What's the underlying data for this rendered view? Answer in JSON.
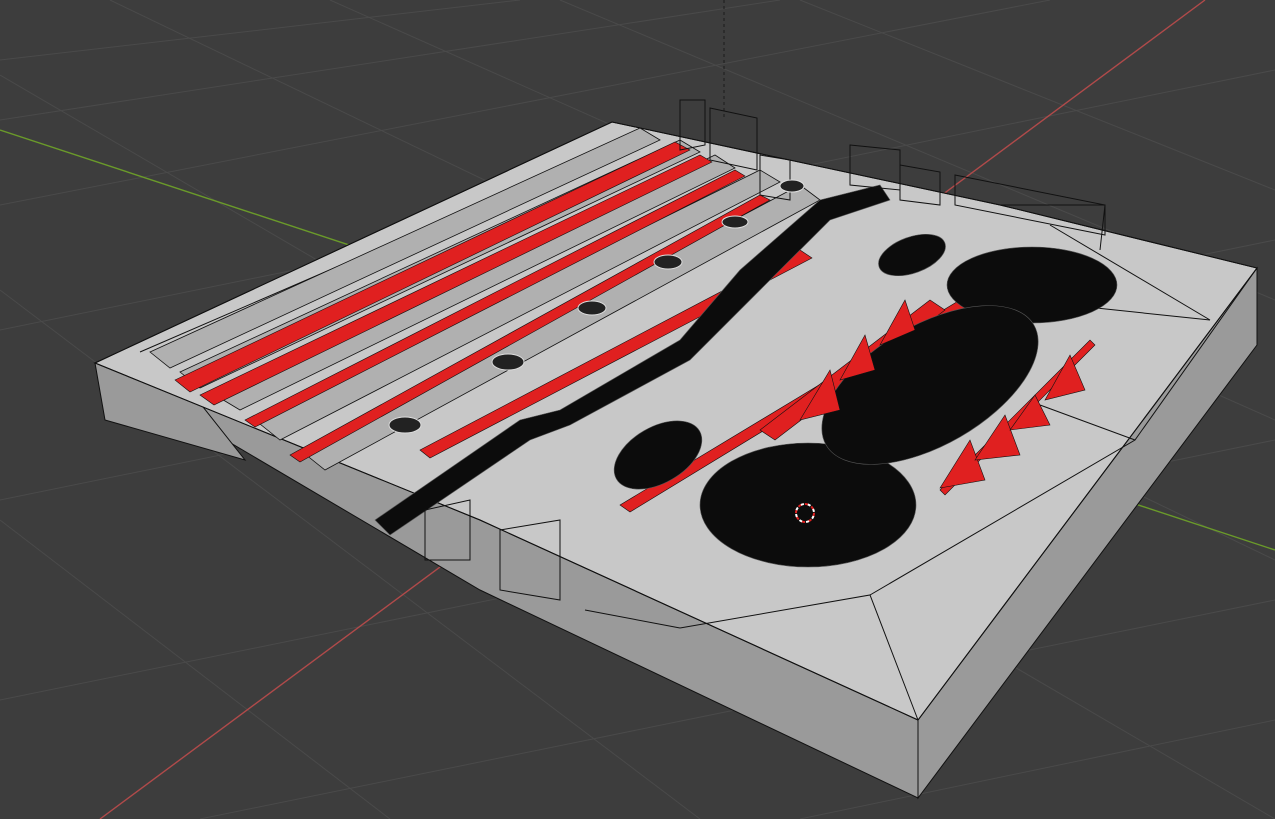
{
  "viewport": {
    "background": "#3d3d3d",
    "grid_color": "#4a4a4a",
    "x_axis_color": "#b04a4a",
    "y_axis_color": "#6a9a2a",
    "z_axis_color": "#1a1a1a"
  },
  "model": {
    "top_face_color": "#c8c8c8",
    "side_face_color": "#9a9a9a",
    "wire_color": "#111111",
    "accent_color": "#e02020",
    "mesh_dark_color": "#0c0c0c"
  },
  "cursor_3d": {
    "icon": "3d-cursor-icon",
    "colors": [
      "#e02020",
      "#ffffff"
    ]
  }
}
